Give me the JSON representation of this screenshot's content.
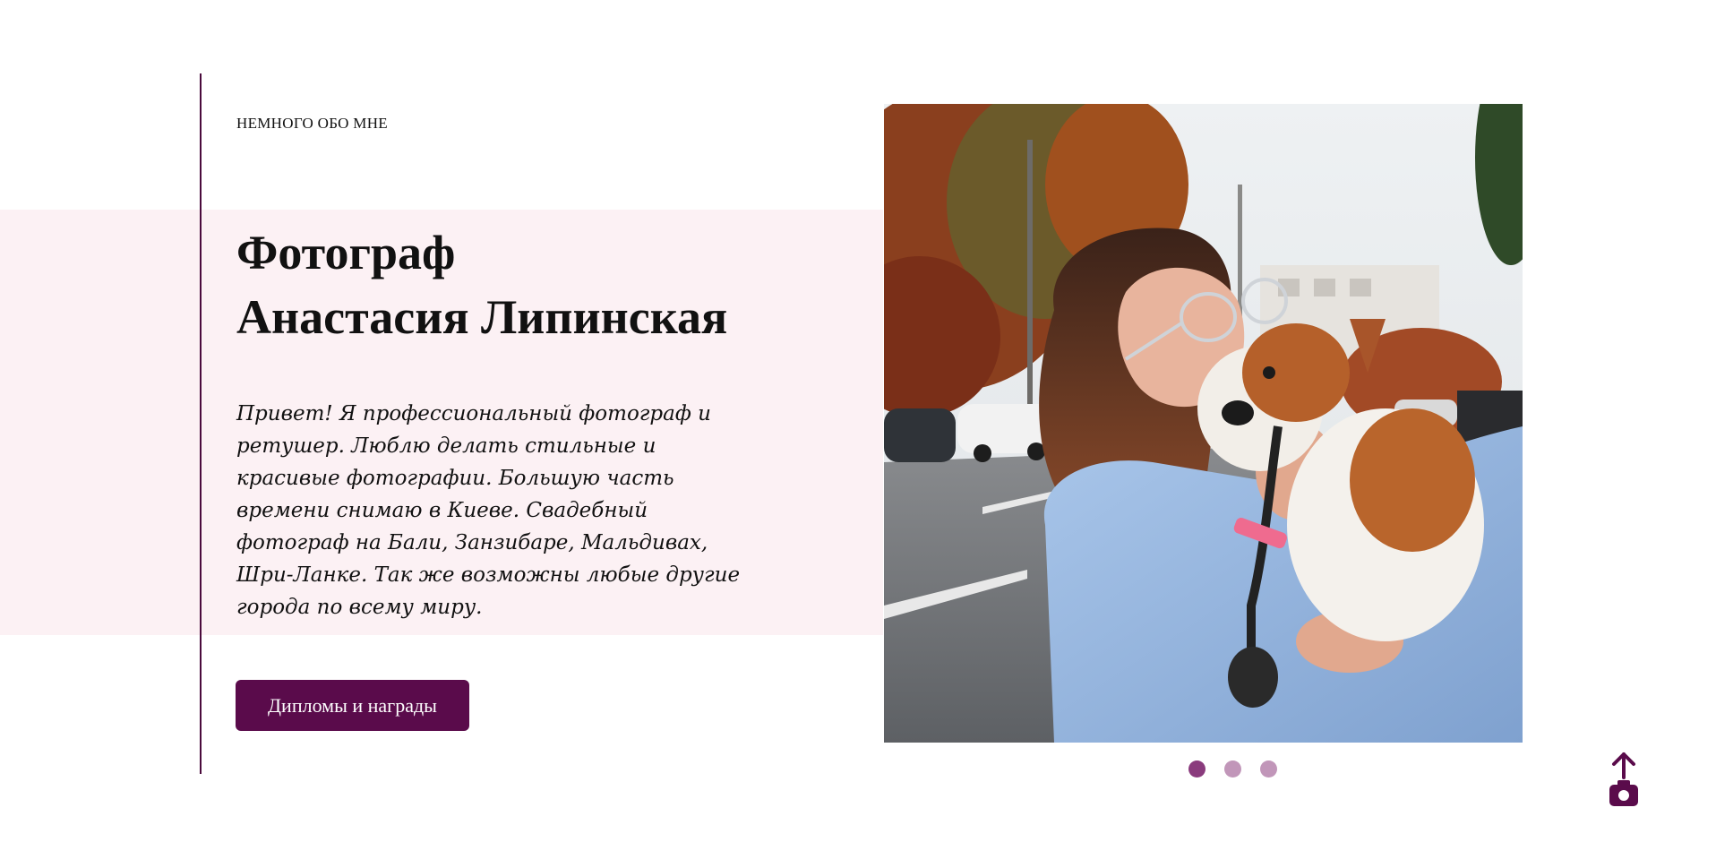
{
  "about": {
    "eyebrow": "НЕМНОГО ОБО МНЕ",
    "title_line1": "Фотограф",
    "title_line2": "Анастасия Липинская",
    "bio": "Привет! Я профессиональный фотограф и ретушер. Люблю делать стильные и красивые фотографии. Большую часть времени снимаю в Киеве. Свадебный фотограф на Бали, Занзибаре, Мальдивах, Шри-Ланке. Так же возможны любые другие города по всему миру.",
    "button_label": "Дипломы и награды"
  },
  "carousel": {
    "slide_count": 3,
    "active_index": 0
  },
  "colors": {
    "brand": "#5a0b4b",
    "band": "#fcf1f4",
    "dot_active": "#8a3b7d",
    "dot_inactive": "#c196b9"
  },
  "icons": {
    "scroll_top": "camera-upload-icon"
  }
}
